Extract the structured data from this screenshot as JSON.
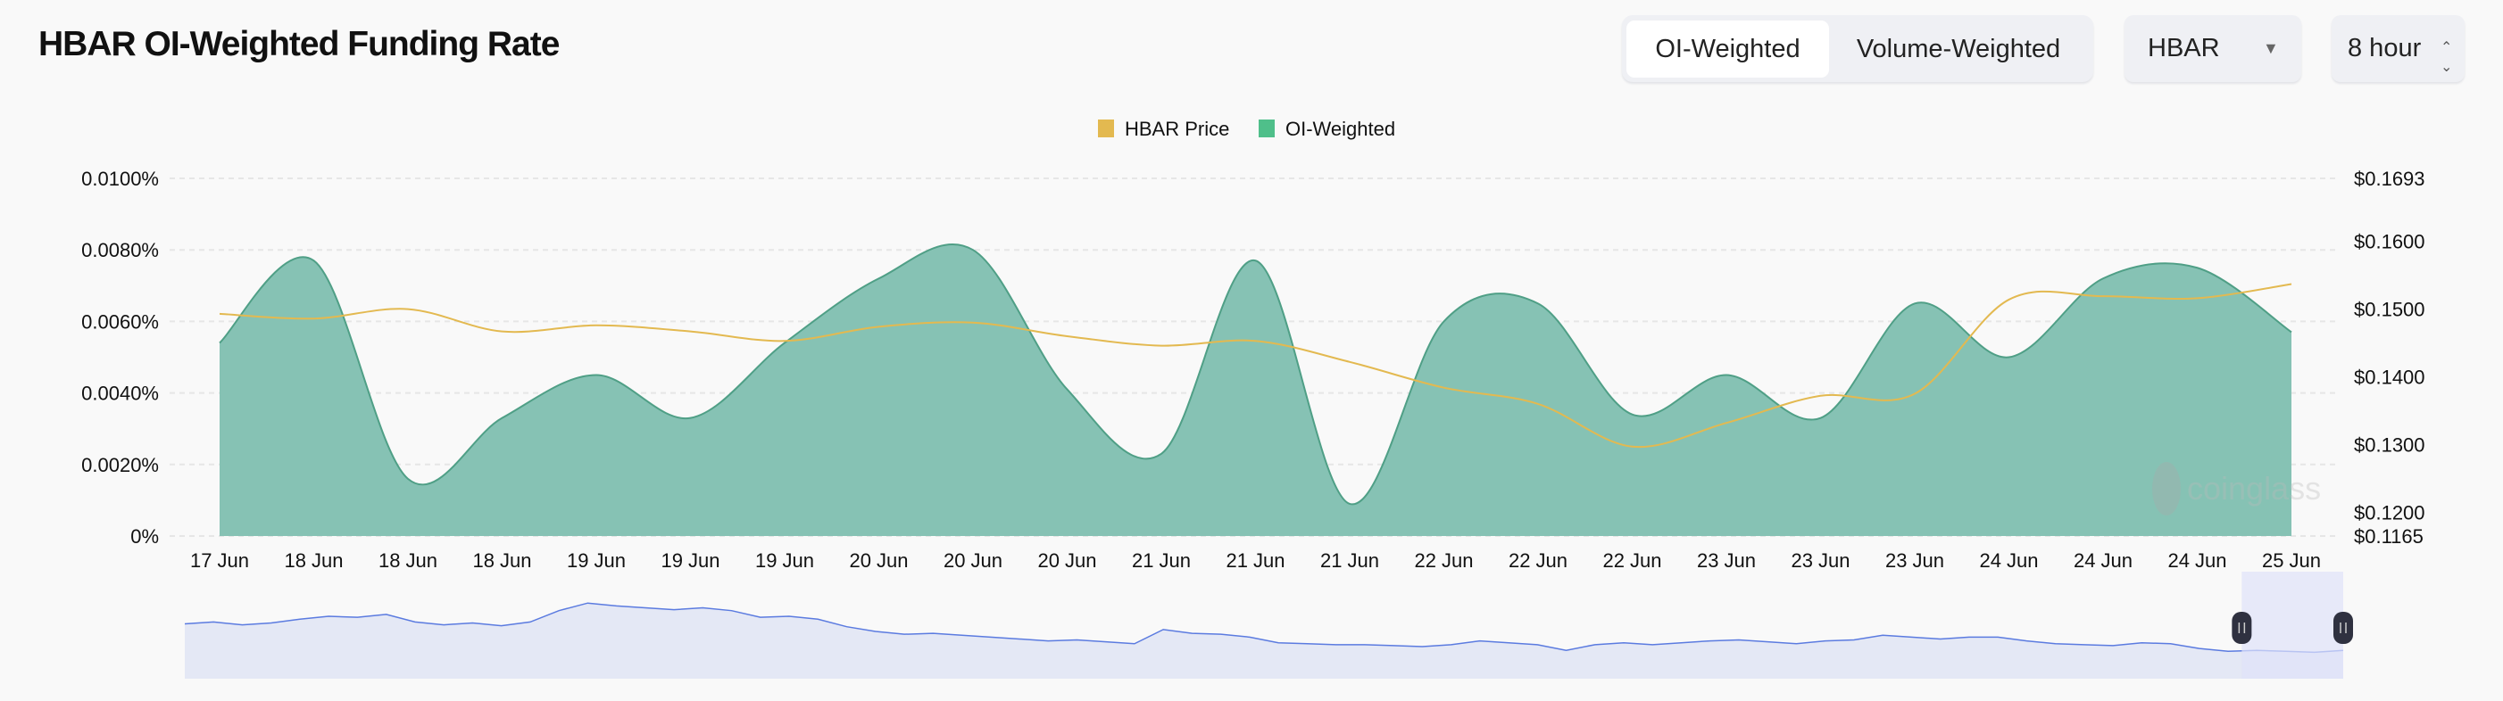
{
  "title": "HBAR OI-Weighted Funding Rate",
  "controls": {
    "tabs": [
      {
        "label": "OI-Weighted",
        "active": true
      },
      {
        "label": "Volume-Weighted",
        "active": false
      }
    ],
    "symbol_select": {
      "value": "HBAR",
      "icon": "caret-down-icon"
    },
    "interval_select": {
      "value": "8 hour",
      "icon": "up-down-chevron-icon"
    }
  },
  "watermark": "coinglass",
  "chart_data": {
    "type": "area",
    "legend": [
      {
        "name": "HBAR Price",
        "color": "#e3b950"
      },
      {
        "name": "OI-Weighted",
        "color": "#4fbf8a"
      }
    ],
    "legend_position": "top-center",
    "categories": [
      "17 Jun",
      "18 Jun",
      "18 Jun",
      "18 Jun",
      "19 Jun",
      "19 Jun",
      "19 Jun",
      "20 Jun",
      "20 Jun",
      "20 Jun",
      "21 Jun",
      "21 Jun",
      "21 Jun",
      "22 Jun",
      "22 Jun",
      "22 Jun",
      "23 Jun",
      "23 Jun",
      "23 Jun",
      "24 Jun",
      "24 Jun",
      "24 Jun",
      "25 Jun"
    ],
    "y_left": {
      "ticks": [
        "0%",
        "0.0020%",
        "0.0040%",
        "0.0060%",
        "0.0080%",
        "0.0100%"
      ],
      "range": [
        0,
        0.01
      ],
      "unit": "%"
    },
    "y_right": {
      "ticks": [
        "$0.1165",
        "$0.1200",
        "$0.1300",
        "$0.1400",
        "$0.1500",
        "$0.1600",
        "$0.1693"
      ],
      "range": [
        0.1165,
        0.1693
      ]
    },
    "grid": true,
    "series": [
      {
        "name": "OI-Weighted",
        "axis": "left",
        "type": "area",
        "color": "#86c2b4",
        "stroke": "#4f9f86",
        "values": [
          0.0054,
          0.0077,
          0.0016,
          0.0033,
          0.0045,
          0.0033,
          0.0054,
          0.0072,
          0.008,
          0.0041,
          0.0023,
          0.0077,
          0.0009,
          0.006,
          0.0065,
          0.0034,
          0.0045,
          0.0033,
          0.0065,
          0.005,
          0.0072,
          0.0075,
          0.0057
        ]
      },
      {
        "name": "HBAR Price",
        "axis": "right",
        "type": "line",
        "color": "#e3b950",
        "values": [
          0.1493,
          0.1486,
          0.15,
          0.1467,
          0.1476,
          0.1467,
          0.1453,
          0.1474,
          0.148,
          0.146,
          0.1446,
          0.1453,
          0.1422,
          0.1384,
          0.136,
          0.1297,
          0.1332,
          0.1372,
          0.1375,
          0.1514,
          0.1519,
          0.1516,
          0.1537
        ]
      }
    ],
    "navigator": {
      "color": "#5b7be0",
      "fill": "#e4e8f5",
      "selection_fill": "#dfe3fa",
      "selected_range_fraction": [
        0.953,
        1.0
      ],
      "values": [
        0.58,
        0.6,
        0.57,
        0.59,
        0.63,
        0.66,
        0.65,
        0.68,
        0.6,
        0.57,
        0.59,
        0.56,
        0.6,
        0.72,
        0.8,
        0.77,
        0.75,
        0.73,
        0.75,
        0.72,
        0.65,
        0.66,
        0.63,
        0.55,
        0.5,
        0.47,
        0.48,
        0.46,
        0.44,
        0.42,
        0.4,
        0.41,
        0.39,
        0.37,
        0.52,
        0.48,
        0.47,
        0.44,
        0.38,
        0.37,
        0.36,
        0.36,
        0.35,
        0.34,
        0.36,
        0.4,
        0.38,
        0.36,
        0.3,
        0.36,
        0.38,
        0.36,
        0.38,
        0.4,
        0.41,
        0.39,
        0.37,
        0.4,
        0.41,
        0.46,
        0.44,
        0.42,
        0.44,
        0.44,
        0.4,
        0.37,
        0.36,
        0.35,
        0.38,
        0.37,
        0.32,
        0.29,
        0.3,
        0.29,
        0.28,
        0.3
      ]
    }
  }
}
